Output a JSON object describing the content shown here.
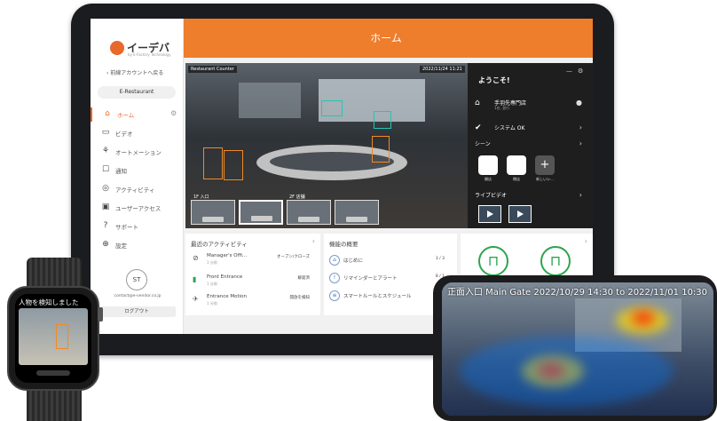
{
  "tablet": {
    "header_title": "ホーム",
    "logo_text": "イーデバ",
    "logo_subtext": "by E-Factory Technology",
    "back_link": "‹ 前線アカウントへ戻る",
    "store_selector": "E-Restaurant",
    "nav": [
      {
        "label": "ホーム",
        "icon": "home-icon",
        "active": true
      },
      {
        "label": "ビデオ",
        "icon": "video-icon"
      },
      {
        "label": "オートメーション",
        "icon": "automation-icon"
      },
      {
        "label": "通知",
        "icon": "notification-icon"
      },
      {
        "label": "アクティビティ",
        "icon": "activity-icon"
      },
      {
        "label": "ユーザーアクセス",
        "icon": "user-access-icon"
      },
      {
        "label": "サポート",
        "icon": "support-icon"
      },
      {
        "label": "設定",
        "icon": "settings-icon"
      }
    ],
    "user_initials": "ST",
    "user_email": "contact@e-vendor.co.jp",
    "logout_label": "ログアウト",
    "camera": {
      "title": "Restaurant Counter",
      "timestamp": "2022/11/24 11:21",
      "thumbnails": [
        {
          "label": "1F 入口"
        },
        {
          "label": ""
        },
        {
          "label": "2F 店舗"
        },
        {
          "label": ""
        }
      ]
    },
    "welcome": {
      "title": "ようこそ!",
      "store_name": "手羽先専門店",
      "store_sub": "1台, 並行",
      "system_status": "システム OK",
      "scene_label": "シーン",
      "scenes": [
        "開店",
        "閉店",
        "新しいシ..."
      ],
      "live_video_label": "ライブビデオ"
    },
    "activity": {
      "title": "最近のアクティビティ",
      "rows": [
        {
          "title": "Manager's Offi...",
          "sub": "1 分前",
          "right": "オープン/クローズ",
          "icon": "key-icon"
        },
        {
          "title": "Front Entrance",
          "sub": "1 分前",
          "right": "解錠済",
          "icon": "door-icon"
        },
        {
          "title": "Entrance Motion",
          "sub": "1 分前",
          "right": "開放を検知",
          "icon": "motion-icon"
        }
      ]
    },
    "shortcuts": {
      "title": "機能の概要",
      "rows": [
        {
          "label": "はじめに",
          "count": "3 / 3"
        },
        {
          "label": "リマインダーとアラート",
          "count": "8 / 1"
        },
        {
          "label": "スマートルールとスケジュール",
          "count": "8"
        }
      ]
    }
  },
  "watch": {
    "alert_text": "人物を検知しました"
  },
  "phone": {
    "overlay_text": "正面入口 Main Gate 2022/10/29 14:30 to 2022/11/01 10:30"
  }
}
